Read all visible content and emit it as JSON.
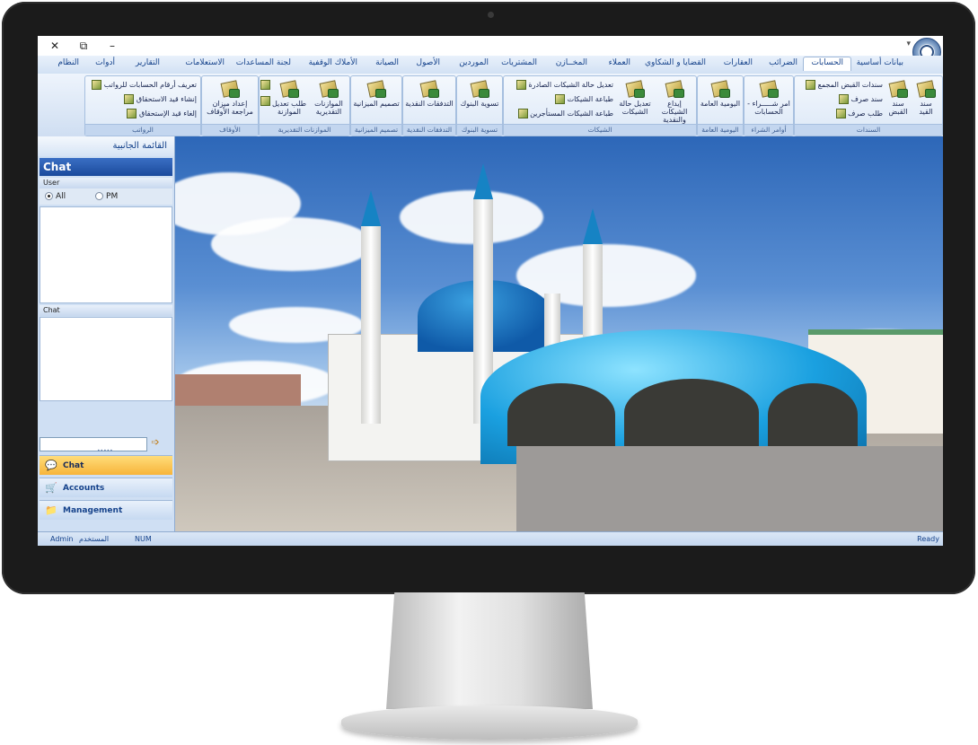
{
  "window": {
    "close_glyph": "✕",
    "restore_glyph": "⧉",
    "minimize_glyph": "–",
    "quick_access_glyph": "▾"
  },
  "menu": [
    {
      "label": "بيانات أساسية",
      "active": false
    },
    {
      "label": "الحسابات",
      "active": true
    },
    {
      "label": "الضرائب",
      "active": false
    },
    {
      "label": "العقارات",
      "active": false
    },
    {
      "label": "القضايا و الشكاوي",
      "active": false
    },
    {
      "label": "العملاء",
      "active": false
    },
    {
      "label": "المخــازن",
      "active": false
    },
    {
      "label": "المشتريات",
      "active": false
    },
    {
      "label": "الموردين",
      "active": false
    },
    {
      "label": "الأصول",
      "active": false
    },
    {
      "label": "الصيانة",
      "active": false
    },
    {
      "label": "الأملاك الوقفية",
      "active": false
    },
    {
      "label": "لجنة المساعدات",
      "active": false
    },
    {
      "label": "الاستعلامات",
      "active": false
    },
    {
      "label": "التقارير",
      "active": false
    },
    {
      "label": "أدوات",
      "active": false
    },
    {
      "label": "النظام",
      "active": false
    }
  ],
  "ribbon": {
    "groups": {
      "sanadat": "السندات",
      "awamer": "أوامر الشراء",
      "yawmiya": "اليومية العامة",
      "shikat": "الشيكات",
      "taswiya": "تسوية البنوك",
      "tadafuqat": "التدفقات النقدية",
      "tasmim": "تصميم الميزانية",
      "muwazanat": "الموازنات التقديرية",
      "awqaf": "الأوقاف",
      "rawatib": "الرواتب"
    },
    "buttons": {
      "sanad_qaid": "سند القيد",
      "sanad_qabd": "سند القبض",
      "sanadat_qabd_mujamma": "سندات القبض المجمع",
      "sanad_sarf": "سند صرف",
      "talab_sarf": "طلب صرف",
      "amr_shira": "امر شـــــراء - الحسابات",
      "yawmiya_amma": "اليومية العامة",
      "ibda_shikat": "إيداع الشيكات والنقدية",
      "tadil_hala": "تعديل حالة الشيكات",
      "tadil_hala_sadira": "تعديل حالة الشيكات الصادرة",
      "tibaat_shikat": "طباعة الشيكات",
      "tibaat_mustajirin": "طباعة الشيكات المستأجرين",
      "taswiyat_bunuk": "تسوية البنوك",
      "tadafuqat_naqdiya": "التدفقات النقدية",
      "tasmim_mizaniya": "تصميم الميزانية",
      "muwazanat_taqdiriya": "الموازنات التقديرية",
      "talab_tadil": "طلب تعديل الموازنة",
      "idad_mizan": "إعداد ميزان مراجعة الأوقاف",
      "tarif_arqam": "تعريف أرقام الحسابات للرواتب",
      "insha_qaid": "إنشاء قيد الاستحقاق",
      "ilgha_qaid": "إلغاء قيد الإستحقاق"
    }
  },
  "sidepane": {
    "title": "القائمة الجانبية",
    "chat_title": "Chat",
    "user_header": "User",
    "radio_all": "All",
    "radio_pm": "PM",
    "chat_header": "Chat",
    "grip": "•••••",
    "send_glyph": "➩",
    "nav": [
      {
        "label": "Chat",
        "selected": true,
        "icon": "chat-icon"
      },
      {
        "label": "Accounts",
        "selected": false,
        "icon": "accounts-icon"
      },
      {
        "label": "Management",
        "selected": false,
        "icon": "management-icon"
      }
    ]
  },
  "status": {
    "user_label": "المستخدم",
    "user_value": "Admin",
    "num": "NUM",
    "ready": "Ready"
  }
}
